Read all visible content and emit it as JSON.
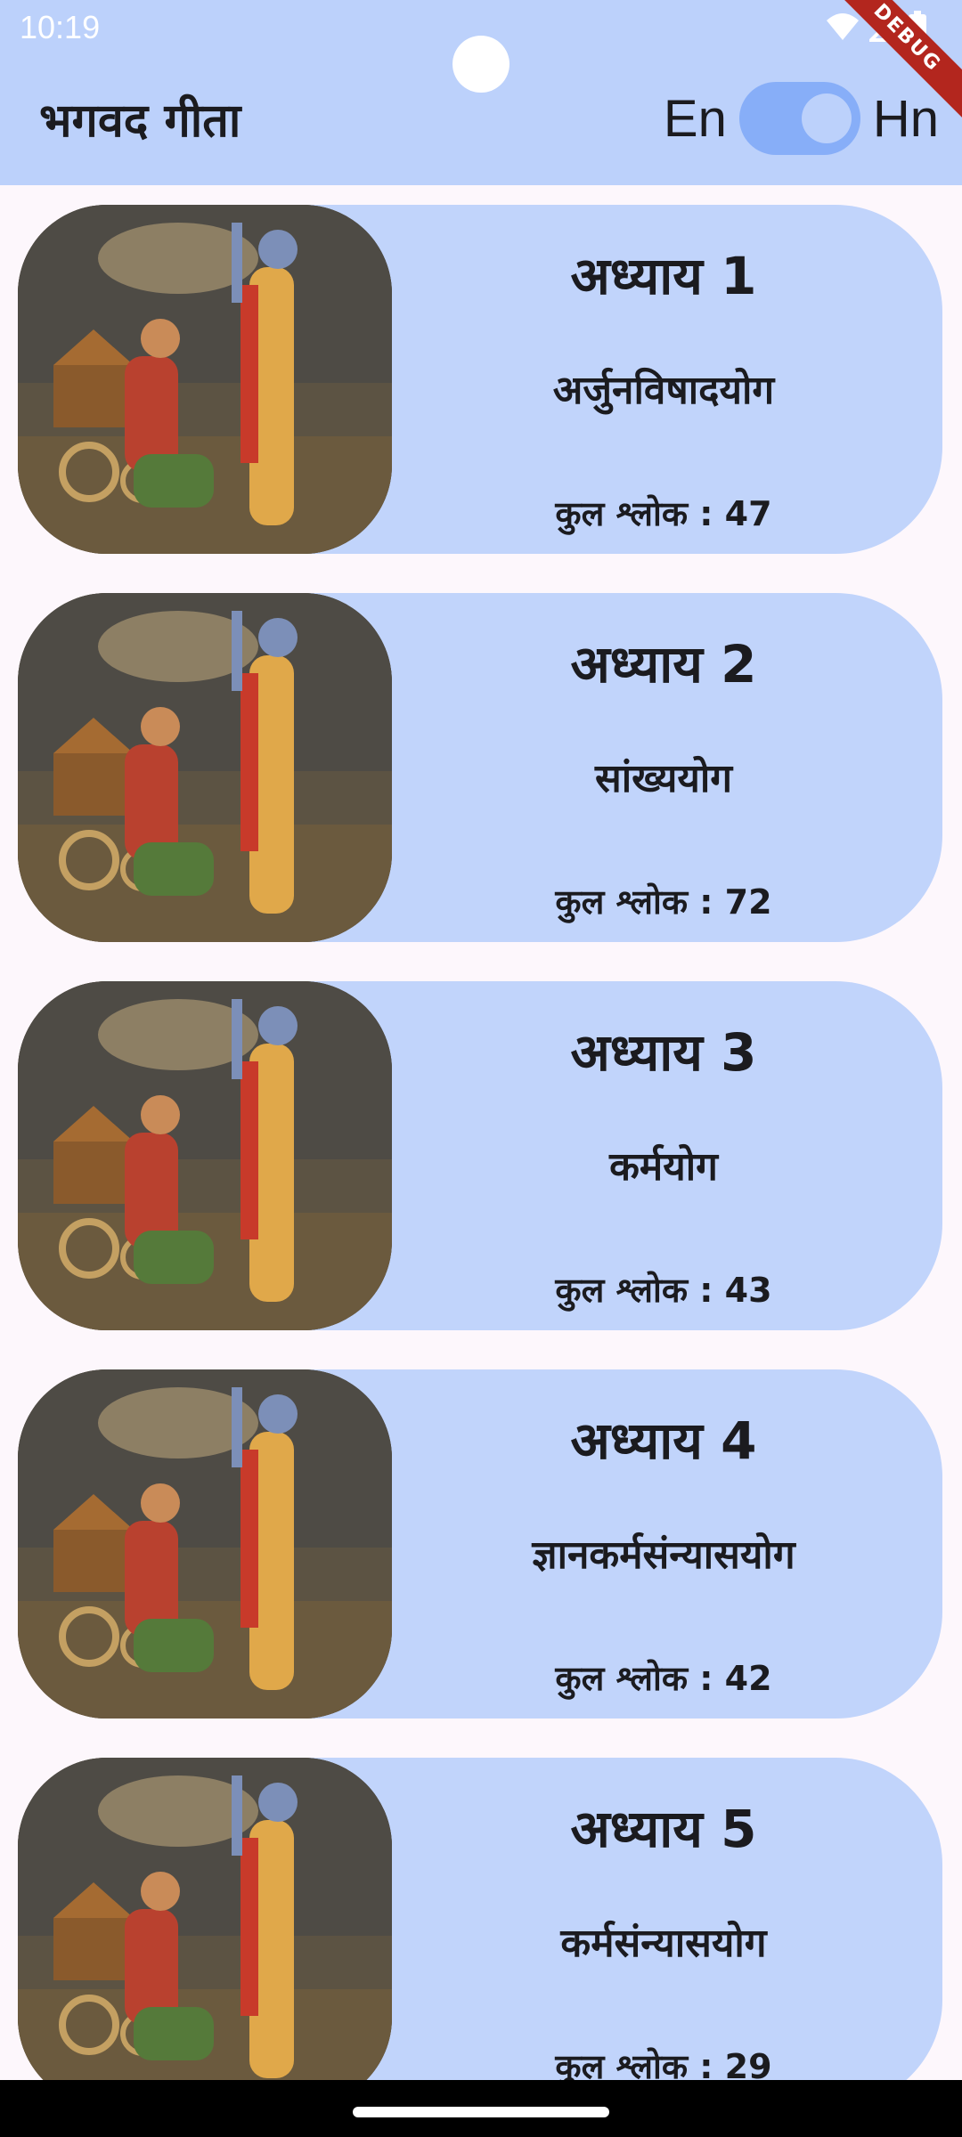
{
  "status_bar": {
    "time": "10:19",
    "icons": [
      "wifi-icon",
      "cell-signal-icon",
      "battery-icon"
    ]
  },
  "debug_banner": "DEBUG",
  "app_bar": {
    "title": "भगवद गीता",
    "lang_left": "En",
    "lang_right": "Hn",
    "toggle_on": true
  },
  "colors": {
    "app_bar": "#bcd1fb",
    "card": "#c1d4fb",
    "toggle_track": "#87aef8",
    "background": "#fdf7fc"
  },
  "chapters": [
    {
      "number": "अध्याय 1",
      "name": "अर्जुनविषादयोग",
      "verses": "कुल श्लोक : 47"
    },
    {
      "number": "अध्याय 2",
      "name": "सांख्ययोग",
      "verses": "कुल श्लोक : 72"
    },
    {
      "number": "अध्याय 3",
      "name": "कर्मयोग",
      "verses": "कुल श्लोक : 43"
    },
    {
      "number": "अध्याय 4",
      "name": "ज्ञानकर्मसंन्यासयोग",
      "verses": "कुल श्लोक : 42"
    },
    {
      "number": "अध्याय 5",
      "name": "कर्मसंन्यासयोग",
      "verses": "कुल श्लोक : 29"
    }
  ]
}
